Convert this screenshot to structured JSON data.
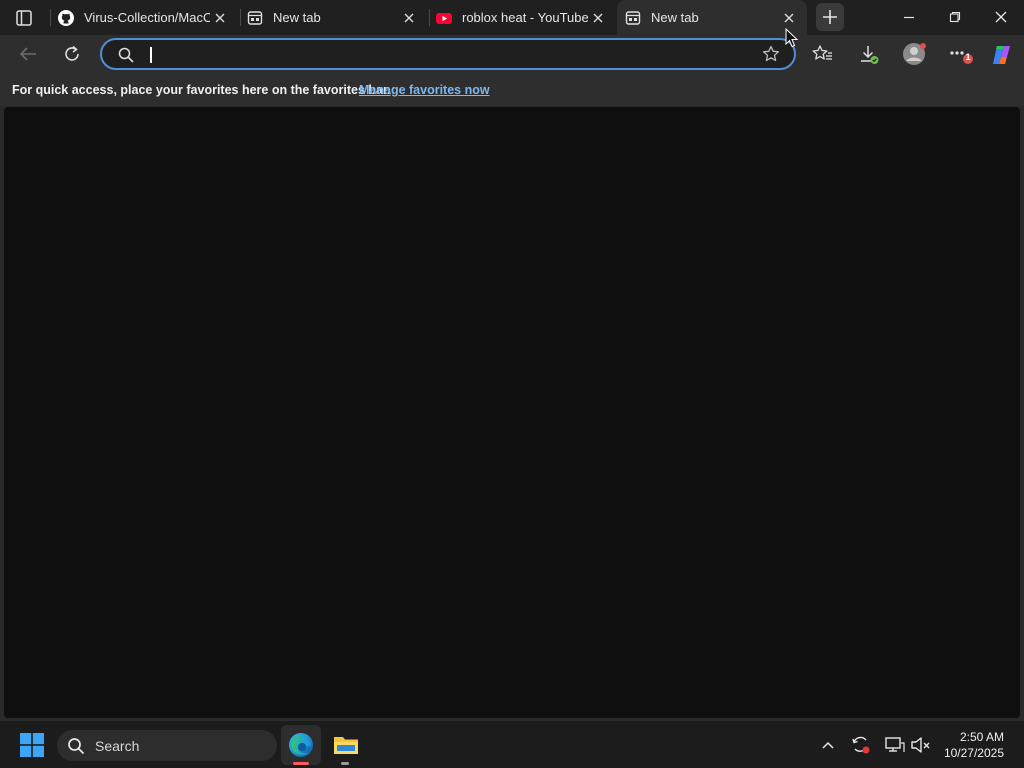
{
  "tabs": [
    {
      "title": "Virus-Collection/MacOS",
      "icon": "github-icon",
      "active": false
    },
    {
      "title": "New tab",
      "icon": "new-tab-page-icon",
      "active": false
    },
    {
      "title": "roblox heat - YouTube",
      "icon": "youtube-icon",
      "active": false
    },
    {
      "title": "New tab",
      "icon": "new-tab-page-icon",
      "active": true
    }
  ],
  "address_bar": {
    "value": "",
    "placeholder": ""
  },
  "favorites_bar": {
    "message": "For quick access, place your favorites here on the favorites bar.",
    "link": "Manage favorites now"
  },
  "toolbar": {
    "extensions_badge": "1"
  },
  "taskbar": {
    "search_label": "Search",
    "time": "2:50 AM",
    "date": "10/27/2025"
  },
  "colors": {
    "accent": "#4f8fd8",
    "link": "#7db8f0",
    "badge": "#d9534f",
    "youtube": "#ff0033"
  }
}
